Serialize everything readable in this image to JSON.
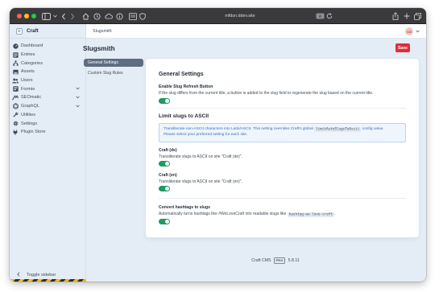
{
  "browser": {
    "url": "mfdsn.ddev.site",
    "icons": [
      "sidebar-icon",
      "back-icon",
      "forward-icon",
      "home-icon",
      "history-icon",
      "cloud-icon",
      "info-icon",
      "reader-icon",
      "shield-icon",
      "share-icon",
      "new-tab-icon",
      "tabs-icon"
    ]
  },
  "site": {
    "logo_letter": "C",
    "name": "Craft"
  },
  "sidebar": {
    "items": [
      {
        "label": "Dashboard",
        "icon": "gauge-icon",
        "has_submenu": false
      },
      {
        "label": "Entries",
        "icon": "entries-icon",
        "has_submenu": false
      },
      {
        "label": "Categories",
        "icon": "categories-icon",
        "has_submenu": false
      },
      {
        "label": "Assets",
        "icon": "assets-icon",
        "has_submenu": false
      },
      {
        "label": "Users",
        "icon": "users-icon",
        "has_submenu": false
      },
      {
        "label": "Formie",
        "icon": "formie-icon",
        "has_submenu": true
      },
      {
        "label": "SEOmatic",
        "icon": "seomatic-icon",
        "has_submenu": true
      },
      {
        "label": "GraphQL",
        "icon": "graphql-icon",
        "has_submenu": true
      },
      {
        "label": "Utilities",
        "icon": "utilities-icon",
        "has_submenu": false
      },
      {
        "label": "Settings",
        "icon": "settings-icon",
        "has_submenu": false
      },
      {
        "label": "Plugin Store",
        "icon": "plug-icon",
        "has_submenu": false
      }
    ],
    "toggle_label": "Toggle sidebar"
  },
  "topbar": {
    "breadcrumb": "Slugsmith",
    "avatar_initials": "CS"
  },
  "page": {
    "title": "Slugsmith",
    "save_label": "Save"
  },
  "subnav": [
    {
      "label": "General Settings",
      "active": true
    },
    {
      "label": "Custom Slug Rules",
      "active": false
    }
  ],
  "settings": {
    "heading": "General Settings",
    "refresh": {
      "label": "Enable Slug Refresh Button",
      "instructions": "If the slug differs from the current title, a button is added to the slug field to regenerate the slug based on the current title.",
      "enabled": true
    },
    "limit": {
      "heading": "Limit slugs to ASCII",
      "tip_line1_a": "Transliterate non-ASCII characters into Latin/ASCII. This setting overrides Craft's global",
      "tip_code": "limitAutoSlugsToAscii",
      "tip_line1_b": "config value.",
      "tip_line2": "Please select your preferred setting for each site."
    },
    "sites": [
      {
        "label": "Craft (de)",
        "instructions": "Transliterate slugs to ASCII on site \"Craft (de)\".",
        "enabled": true
      },
      {
        "label": "Craft (en)",
        "instructions": "Transliterate slugs to ASCII on site \"Craft (en)\".",
        "enabled": true
      }
    ],
    "hashtag": {
      "label": "Convert hashtags to slugs",
      "instructions": "Automatically turns hashtags like #WeLoveCraft into readable slugs like",
      "code": "hashtag-we-love-craft",
      "suffix": ".",
      "enabled": true
    }
  },
  "footer": {
    "product": "Craft CMS",
    "edition": "PRO",
    "version": "5.8.11"
  },
  "colors": {
    "accent_red": "#e12d39",
    "toggle_green": "#1e9a63",
    "sidebar_bg": "#e4edf6",
    "active_nav": "#5e6e80",
    "tip_blue": "#3d6fb6"
  }
}
